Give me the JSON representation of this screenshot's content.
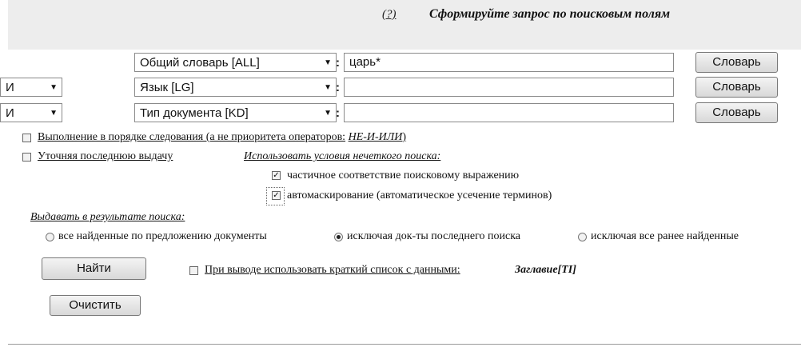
{
  "header": {
    "help": "(?)",
    "title": "Сформируйте запрос по поисковым полям"
  },
  "rows": [
    {
      "operator": "",
      "field": "Общий словарь [ALL]",
      "value": "царь*",
      "button": "Словарь"
    },
    {
      "operator": "И",
      "field": "Язык [LG]",
      "value": "",
      "button": "Словарь"
    },
    {
      "operator": "И",
      "field": "Тип документа [KD]",
      "value": "",
      "button": "Словарь"
    }
  ],
  "options": {
    "order_label": "Выполнение в порядке следования (а не приоритета операторов:",
    "order_ops": "НЕ-И-ИЛИ",
    "order_close": ")",
    "refine_label": "Уточняя последнюю выдачу",
    "fuzzy_title": "Использовать условия нечеткого поиска:",
    "partial_label": "частичное соответствие поисковому выражению",
    "partial_checked": true,
    "automask_label": "автомаскирование (автоматическое усечение терминов)",
    "automask_checked": true
  },
  "results": {
    "title": "Выдавать в результате поиска:",
    "radios": [
      {
        "label": "все найденные по предложению документы",
        "selected": false
      },
      {
        "label": "исключая док-ты последнего поиска",
        "selected": true
      },
      {
        "label": "исключая все ранее найденные",
        "selected": false
      }
    ]
  },
  "actions": {
    "find": "Найти",
    "clear": "Очистить",
    "brief_label": "При выводе использовать краткий список с данными:",
    "brief_value": "Заглавие[TI]"
  },
  "icons": {
    "checkmark": "✓",
    "dropdown": "▼"
  }
}
